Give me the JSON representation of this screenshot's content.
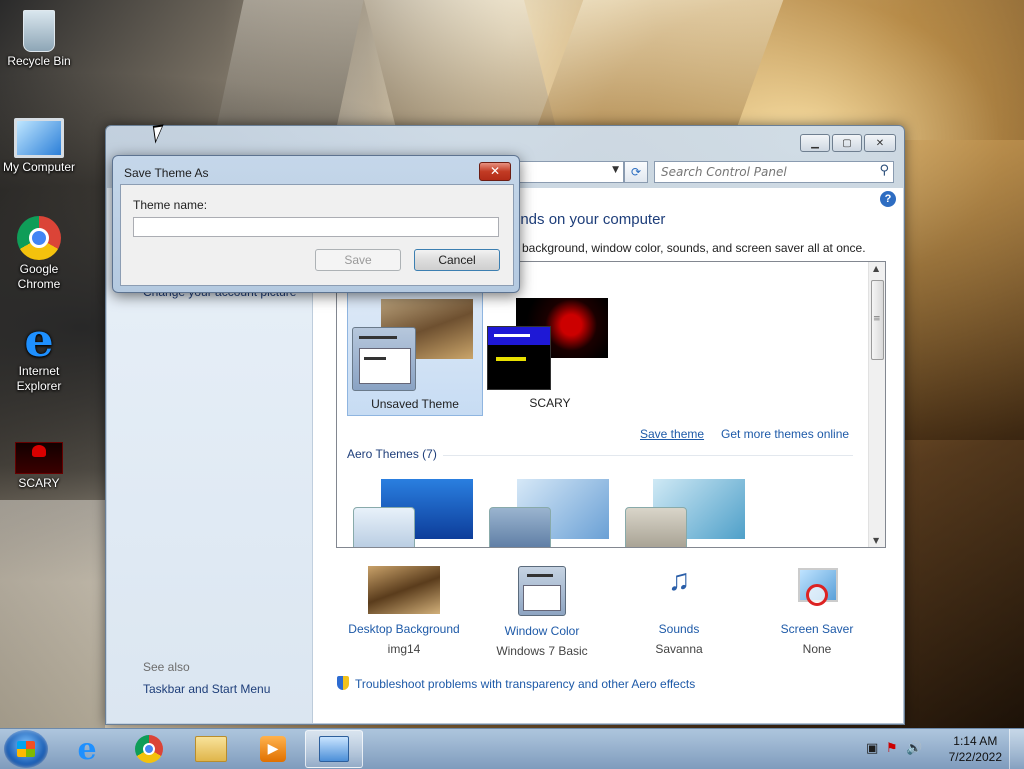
{
  "desktop": {
    "icons": [
      {
        "label": "Recycle Bin",
        "icon": "recycle-bin-icon"
      },
      {
        "label": "My Computer",
        "icon": "computer-icon"
      },
      {
        "label": "Google Chrome",
        "icon": "chrome-icon"
      },
      {
        "label": "Internet Explorer",
        "icon": "internet-explorer-icon"
      },
      {
        "label": "SCARY",
        "icon": "scary-theme-icon"
      }
    ]
  },
  "control_panel": {
    "search_placeholder": "Search Control Panel",
    "help_glyph": "?",
    "heading": "unds on your computer",
    "subheading": "p background, window color, sounds, and screen saver all at once.",
    "left": {
      "link_account_picture": "Change your account picture",
      "see_also": "See also",
      "link_taskbar": "Taskbar and Start Menu"
    },
    "my_themes": [
      {
        "label": "Unsaved Theme",
        "selected": true
      },
      {
        "label": "SCARY",
        "selected": false
      }
    ],
    "links": {
      "save_theme": "Save theme",
      "get_more": "Get more themes online"
    },
    "aero_group_label": "Aero Themes (7)",
    "settings": [
      {
        "name": "Desktop Background",
        "value": "img14",
        "icon": "desktop-background-icon"
      },
      {
        "name": "Window Color",
        "value": "Windows 7 Basic",
        "icon": "window-color-icon"
      },
      {
        "name": "Sounds",
        "value": "Savanna",
        "icon": "sounds-icon"
      },
      {
        "name": "Screen Saver",
        "value": "None",
        "icon": "screen-saver-icon"
      }
    ],
    "troubleshoot": "Troubleshoot problems with transparency and other Aero effects"
  },
  "dialog": {
    "title": "Save Theme As",
    "close_glyph": "✕",
    "field_label": "Theme name:",
    "field_value": "",
    "save_label": "Save",
    "cancel_label": "Cancel"
  },
  "taskbar": {
    "time": "1:14 AM",
    "date": "7/22/2022"
  }
}
